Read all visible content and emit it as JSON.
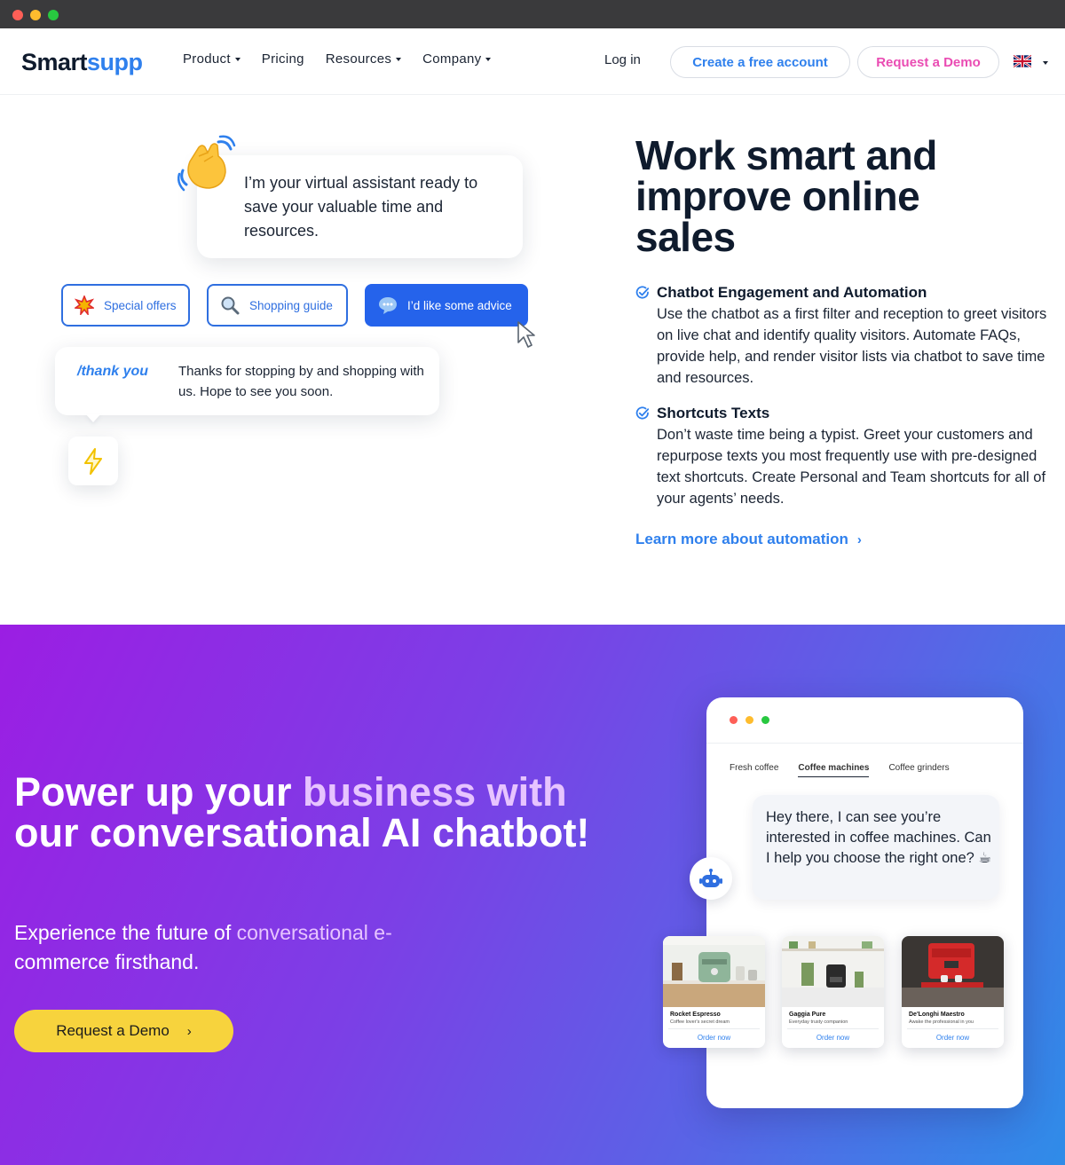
{
  "header": {
    "logo": {
      "part1": "Smart",
      "part2": "supp"
    },
    "nav": [
      {
        "label": "Product",
        "dropdown": true
      },
      {
        "label": "Pricing",
        "dropdown": false
      },
      {
        "label": "Resources",
        "dropdown": true
      },
      {
        "label": "Company",
        "dropdown": true
      }
    ],
    "login": "Log in",
    "create_account": "Create a free account",
    "request_demo": "Request a Demo",
    "language_icon": "uk-flag-icon"
  },
  "illustration": {
    "assistant_message": "I’m your virtual assistant ready to save your valuable time and resources.",
    "chips": [
      {
        "label": "Special offers",
        "icon": "star-burst-icon"
      },
      {
        "label": "Shopping guide",
        "icon": "magnifier-icon"
      },
      {
        "label": "I’d like some advice",
        "icon": "speech-bubble-icon"
      }
    ],
    "shortcut_command": "/thank you",
    "shortcut_text": "Thanks for stopping by and shopping with us. Hope to see you soon."
  },
  "automation": {
    "title": "Work smart and improve online sales",
    "features": [
      {
        "title": "Chatbot Engagement and Automation",
        "text": "Use the chatbot as a first filter and reception to greet visitors on live chat and identify quality visitors. Automate FAQs, provide help, and render visitor lists via chatbot to save time and resources."
      },
      {
        "title": "Shortcuts Texts",
        "text": "Don’t waste time being a typist. Greet your customers and repurpose texts you most frequently use with pre-designed text shortcuts. Create Personal and Team shortcuts for all of your agents’ needs."
      }
    ],
    "learn_more": "Learn more about automation",
    "learn_more_chevron": "›"
  },
  "hero": {
    "title_part1": "Power up your ",
    "title_highlight": "business with",
    "title_part2": "our conversational AI chatbot!",
    "subtitle_part1": "Experience the future of ",
    "subtitle_highlight": "conversational e-",
    "subtitle_part2": "commerce firsthand.",
    "cta_label": "Request a Demo",
    "cta_chevron": "›"
  },
  "mockup": {
    "tabs": [
      {
        "label": "Fresh coffee",
        "active": false
      },
      {
        "label": "Coffee machines",
        "active": true
      },
      {
        "label": "Coffee grinders",
        "active": false
      }
    ],
    "bot_message": "Hey there, I can see you’re interested in coffee machines. Can I help you choose the right one? ☕",
    "products": [
      {
        "name": "Rocket Espresso",
        "desc": "Coffee lover's secret dream",
        "order": "Order now"
      },
      {
        "name": "Gaggia Pure",
        "desc": "Everyday trusty companion",
        "order": "Order now"
      },
      {
        "name": "De'Longhi Maestro",
        "desc": "Awake the professional in you",
        "order": "Order now"
      }
    ]
  },
  "colors": {
    "brand_blue": "#2f80ed",
    "brand_pink": "#ea4cb3",
    "cta_yellow": "#f7d33d",
    "hero_gradient_start": "#9b1ee3",
    "hero_gradient_end": "#2f8ce8",
    "dark_text": "#0f1b2d"
  }
}
